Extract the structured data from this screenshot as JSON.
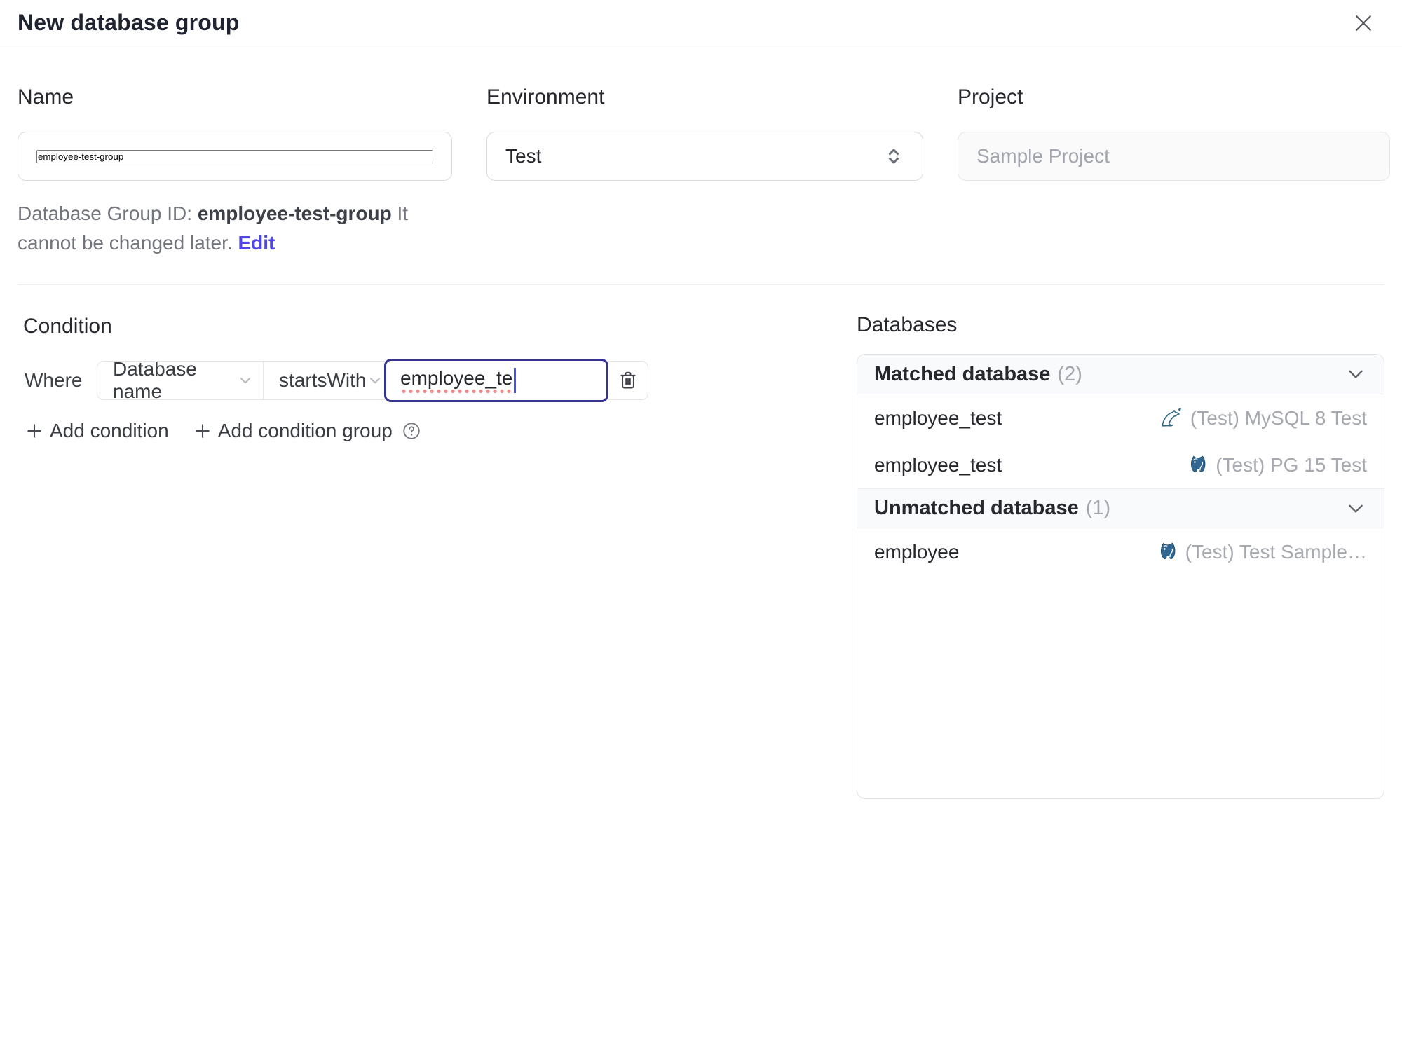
{
  "dialog": {
    "title": "New database group"
  },
  "form": {
    "name": {
      "label": "Name",
      "value": "employee-test-group"
    },
    "environment": {
      "label": "Environment",
      "value": "Test"
    },
    "project": {
      "label": "Project",
      "value": "Sample Project"
    },
    "group_id_note": {
      "prefix": "Database Group ID: ",
      "id": "employee-test-group",
      "text": " It cannot be changed later. ",
      "edit_label": "Edit"
    }
  },
  "condition": {
    "heading": "Condition",
    "where_label": "Where",
    "factor": "Database name",
    "operator": "startsWith",
    "value": "employee_te",
    "add_condition_label": "Add condition",
    "add_condition_group_label": "Add condition group"
  },
  "databases": {
    "heading": "Databases",
    "matched_title": "Matched database",
    "matched_count": "(2)",
    "matched_rows": [
      {
        "name": "employee_test",
        "engine": "mysql",
        "instance": "(Test) MySQL 8 Test"
      },
      {
        "name": "employee_test",
        "engine": "postgresql",
        "instance": "(Test) PG 15 Test"
      }
    ],
    "unmatched_title": "Unmatched database",
    "unmatched_count": "(1)",
    "unmatched_rows": [
      {
        "name": "employee",
        "engine": "postgresql",
        "instance": "(Test) Test Sample…"
      }
    ]
  },
  "icons": {
    "close": "x-cross",
    "select_updown": "chevron-up-down",
    "chevron_down": "chevron-down",
    "trash": "trash-can",
    "plus": "+",
    "help": "?",
    "mysql": "mysql-dolphin",
    "postgresql": "postgres-elephant",
    "caret": "text-cursor"
  },
  "colors": {
    "accent": "#4f46e5",
    "focused_input_border": "#363390",
    "spellcheck_underline": "#f48a8a",
    "panel_header_bg": "#f9fafb",
    "border": "#e4e4e8",
    "muted_text": "#a7a9b0",
    "mysql_icon": "#336b87",
    "postgres_icon": "#336791"
  }
}
